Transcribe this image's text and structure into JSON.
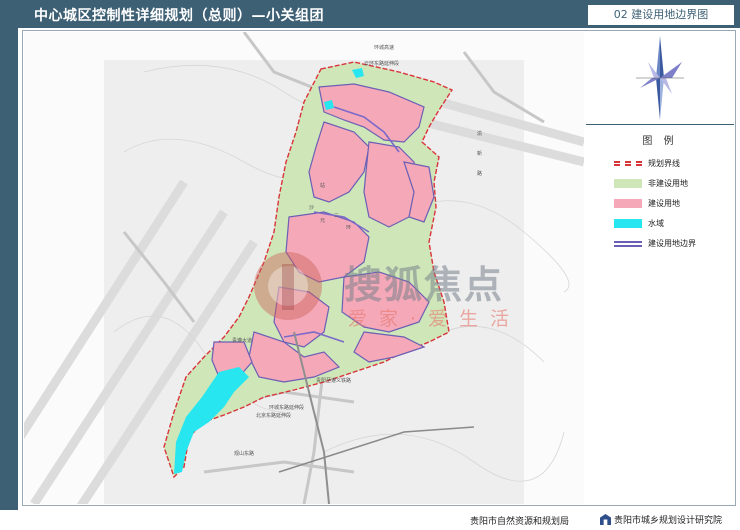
{
  "header": {
    "title": "中心城区控制性详细规划（总则）—小关组团",
    "sheet": "02  建设用地边界图"
  },
  "legend": {
    "title": "图 例",
    "items": [
      {
        "label": "规划界线",
        "color": "#d9343a"
      },
      {
        "label": "非建设用地",
        "color": "#cfe6b8"
      },
      {
        "label": "建设用地",
        "color": "#f5a8b8"
      },
      {
        "label": "水域",
        "color": "#27e6ef"
      },
      {
        "label": "建设用地边界",
        "color": "#6a5fb5"
      }
    ]
  },
  "footer": {
    "left": "贵阳市自然资源和规划局",
    "right": "贵阳市城乡规划设计研究院"
  },
  "map_labels": {
    "road1": "环城高速",
    "road2": "云环东路延伸段",
    "road3": "渝",
    "road4": "新",
    "road5": "路",
    "road6": "贵遵大道",
    "road7": "北京东路延伸段",
    "road8": "贵阳至遵义铁路",
    "road9": "环城东路延伸段",
    "road10": "观山东路",
    "road11": "站",
    "road12": "沙",
    "road13": "元",
    "road14": "二",
    "road15": "环"
  },
  "watermark": {
    "brand": "搜狐焦点",
    "slogan": "爱家·爱生活"
  }
}
